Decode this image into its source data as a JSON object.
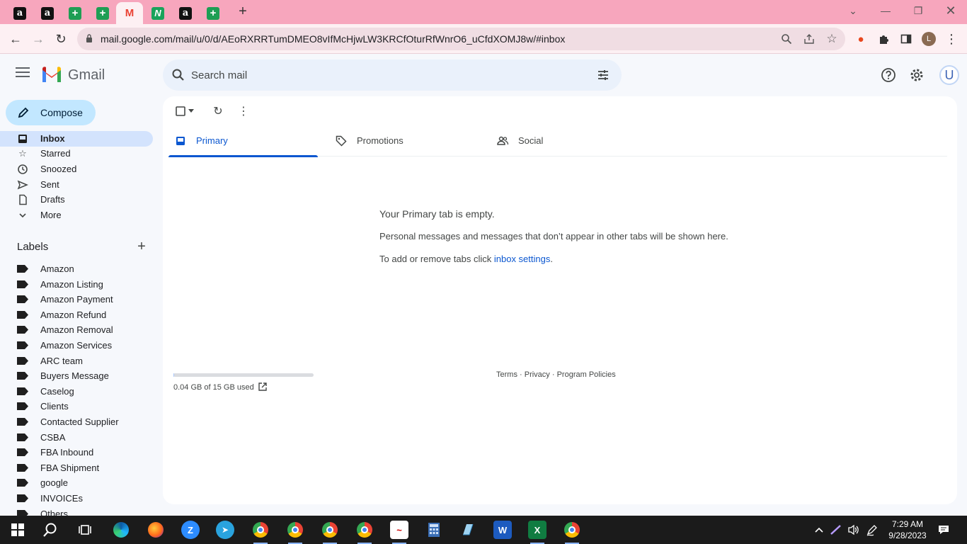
{
  "browser": {
    "tabs": [
      {
        "icon": "amazon-icon",
        "glyph": "a"
      },
      {
        "icon": "amazon-icon",
        "glyph": "a"
      },
      {
        "icon": "sheets-icon",
        "glyph": "+"
      },
      {
        "icon": "sheets-icon",
        "glyph": "+"
      },
      {
        "icon": "gmail-icon",
        "glyph": "M"
      },
      {
        "icon": "n-app-icon",
        "glyph": "N"
      },
      {
        "icon": "amazon-icon",
        "glyph": "a"
      },
      {
        "icon": "sheets-icon",
        "glyph": "+"
      }
    ],
    "url": "mail.google.com/mail/u/0/d/AEoRXRRTumDMEO8vIfMcHjwLW3KRCfOturRfWnrO6_uCfdXOMJ8w/#inbox",
    "profile_initial": "L"
  },
  "gmail": {
    "app_name": "Gmail",
    "search_placeholder": "Search mail",
    "avatar_initial": "U",
    "compose_label": "Compose",
    "nav": [
      {
        "label": "Inbox",
        "icon": "inbox-icon",
        "active": true
      },
      {
        "label": "Starred",
        "icon": "star-icon"
      },
      {
        "label": "Snoozed",
        "icon": "clock-icon"
      },
      {
        "label": "Sent",
        "icon": "send-icon"
      },
      {
        "label": "Drafts",
        "icon": "draft-icon"
      },
      {
        "label": "More",
        "icon": "chevron-down-icon"
      }
    ],
    "labels_title": "Labels",
    "labels": [
      "Amazon",
      "Amazon Listing",
      "Amazon Payment",
      "Amazon Refund",
      "Amazon Removal",
      "Amazon Services",
      "ARC team",
      "Buyers Message",
      "Caselog",
      "Clients",
      "Contacted Supplier",
      "CSBA",
      "FBA Inbound",
      "FBA Shipment",
      "google",
      "INVOICEs",
      "Others"
    ],
    "category_tabs": [
      {
        "label": "Primary",
        "icon": "inbox-icon",
        "active": true
      },
      {
        "label": "Promotions",
        "icon": "tag-icon"
      },
      {
        "label": "Social",
        "icon": "people-icon"
      }
    ],
    "empty": {
      "title": "Your Primary tab is empty.",
      "description": "Personal messages and messages that don’t appear in other tabs will be shown here.",
      "settings_prefix": "To add or remove tabs click ",
      "settings_link": "inbox settings",
      "settings_suffix": "."
    },
    "storage": {
      "text": "0.04 GB of 15 GB used",
      "used_fraction": 0.003
    },
    "footer": {
      "terms": "Terms",
      "privacy": "Privacy",
      "policies": "Program Policies",
      "sep": " · "
    }
  },
  "taskbar": {
    "time": "7:29 AM",
    "date": "9/28/2023"
  },
  "colors": {
    "tabstrip": "#f7a6bd",
    "accent": "#0b57d0",
    "compose": "#c2e7ff",
    "active_nav": "#d3e3fd"
  }
}
